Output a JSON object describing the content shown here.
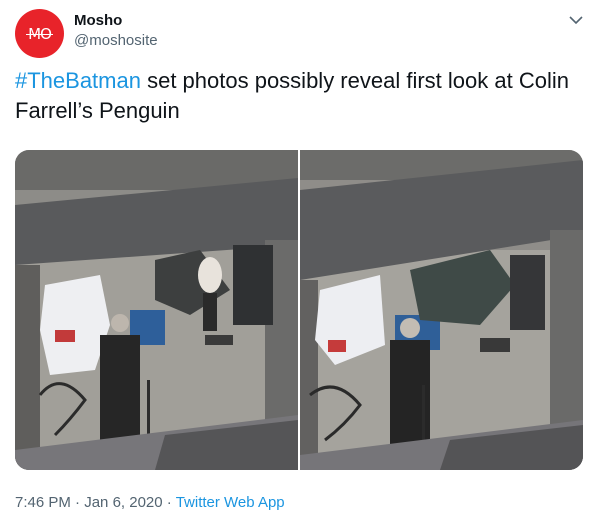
{
  "author": {
    "display_name": "Mosho",
    "handle": "@moshosite",
    "avatar_text": "MO",
    "avatar_color": "#e8232a"
  },
  "tweet": {
    "hashtag": "#TheBatman",
    "text_rest": " set photos possibly reveal first look at Colin Farrell’s Penguin"
  },
  "media": {
    "photos": [
      {
        "icon": "set-photo-1"
      },
      {
        "icon": "set-photo-2"
      }
    ]
  },
  "meta": {
    "time": "7:46 PM",
    "separator1": " · ",
    "date": "Jan 6, 2020",
    "separator2": " · ",
    "source_app": "Twitter Web App"
  },
  "colors": {
    "link": "#1b95e0",
    "secondary_text": "#536471",
    "primary_text": "#0f1419"
  }
}
